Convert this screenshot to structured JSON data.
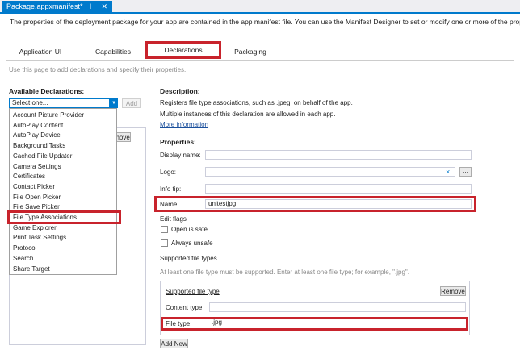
{
  "document_tab": {
    "title": "Package.appxmanifest*",
    "pin_icon": "pin-icon",
    "close_icon": "close-icon"
  },
  "intro_text": "The properties of the deployment package for your app are contained in the app manifest file. You can use the Manifest Designer to set or modify one or more of the properties.",
  "tabs": [
    {
      "label": "Application UI"
    },
    {
      "label": "Capabilities"
    },
    {
      "label": "Declarations",
      "selected": true
    },
    {
      "label": "Packaging"
    }
  ],
  "page_hint": "Use this page to add declarations and specify their properties.",
  "available": {
    "heading": "Available Declarations:",
    "select_value": "Select one...",
    "add_label": "Add",
    "options": [
      "Account Picture Provider",
      "AutoPlay Content",
      "AutoPlay Device",
      "Background Tasks",
      "Cached File Updater",
      "Camera Settings",
      "Certificates",
      "Contact Picker",
      "File Open Picker",
      "File Save Picker",
      "File Type Associations",
      "Game Explorer",
      "Print Task Settings",
      "Protocol",
      "Search",
      "Share Target"
    ],
    "highlighted_option": "File Type Associations",
    "remove_fragment": "move"
  },
  "description": {
    "heading": "Description:",
    "line1": "Registers file type associations, such as .jpeg, on behalf of the app.",
    "line2": "Multiple instances of this declaration are allowed in each app.",
    "more_link": "More information"
  },
  "properties": {
    "heading": "Properties:",
    "display_name_label": "Display name:",
    "display_name_value": "",
    "logo_label": "Logo:",
    "logo_value": "",
    "logo_clear": "×",
    "browse_label": "...",
    "info_tip_label": "Info tip:",
    "info_tip_value": "",
    "name_label": "Name:",
    "name_value": "unitestjpg",
    "edit_flags_label": "Edit flags",
    "open_is_safe_label": "Open is safe",
    "open_is_safe_checked": false,
    "always_unsafe_label": "Always unsafe",
    "always_unsafe_checked": false
  },
  "supported_types": {
    "heading": "Supported file types",
    "hint": "At least one file type must be supported. Enter at least one file type; for example, \".jpg\".",
    "group_title": "Supported file type",
    "remove_label": "Remove",
    "content_type_label": "Content type:",
    "content_type_value": "",
    "file_type_label": "File type:",
    "file_type_value": ".jpg",
    "add_new_label": "Add New"
  },
  "colors": {
    "accent": "#007acc",
    "highlight": "#c8232c",
    "link": "#1a4f9c"
  }
}
